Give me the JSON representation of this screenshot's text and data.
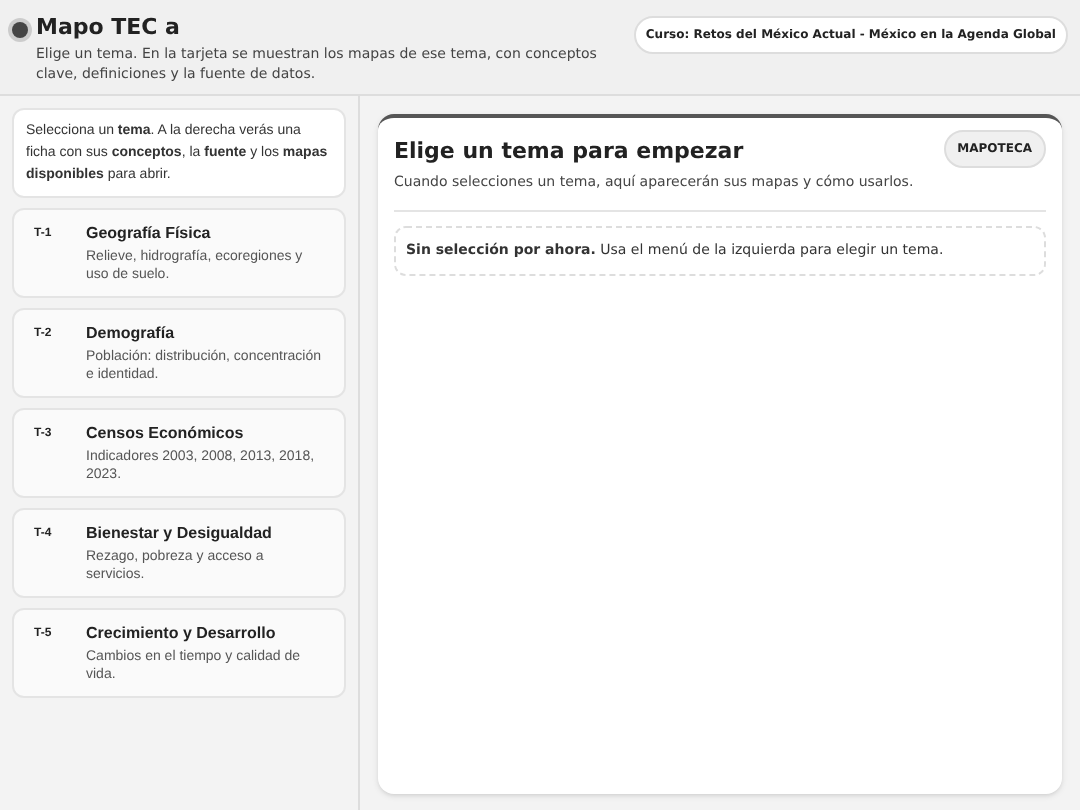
{
  "header": {
    "title": "Mapo TEC a",
    "subtitle": "Elige un tema. En la tarjeta se muestran los mapas de ese tema, con conceptos clave, definiciones y la fuente de datos.",
    "course_badge": "Curso: Retos del México Actual - México en la Agenda Global"
  },
  "sidebar": {
    "intro": "Selecciona un **tema**. A la derecha verás una ficha con sus **conceptos**, la **fuente** y los **mapas disponibles** para abrir.",
    "topics": [
      {
        "code": "T-1",
        "title": "Geografía Física",
        "description": "Relieve, hidrografía, ecoregiones y uso de suelo.",
        "selected": false
      },
      {
        "code": "T-2",
        "title": "Demografía",
        "description": "Población: distribución, concentración e identidad.",
        "selected": false
      },
      {
        "code": "T-3",
        "title": "Censos Económicos",
        "description": "Indicadores 2003, 2008, 2013, 2018, 2023.",
        "selected": false
      },
      {
        "code": "T-4",
        "title": "Bienestar y Desigualdad",
        "description": "Rezago, pobreza y acceso a servicios.",
        "selected": false
      },
      {
        "code": "T-5",
        "title": "Crecimiento y Desarrollo",
        "description": "Cambios en el tiempo y calidad de vida.",
        "selected": false
      }
    ]
  },
  "panel": {
    "title": "Elige un tema para empezar",
    "badge": "MAPOTECA",
    "description": "Cuando selecciones un tema, aquí aparecerán sus mapas y cómo usarlos.",
    "notice": "**Sin selección por ahora.** Usa el menú de la izquierda para elegir un tema."
  }
}
